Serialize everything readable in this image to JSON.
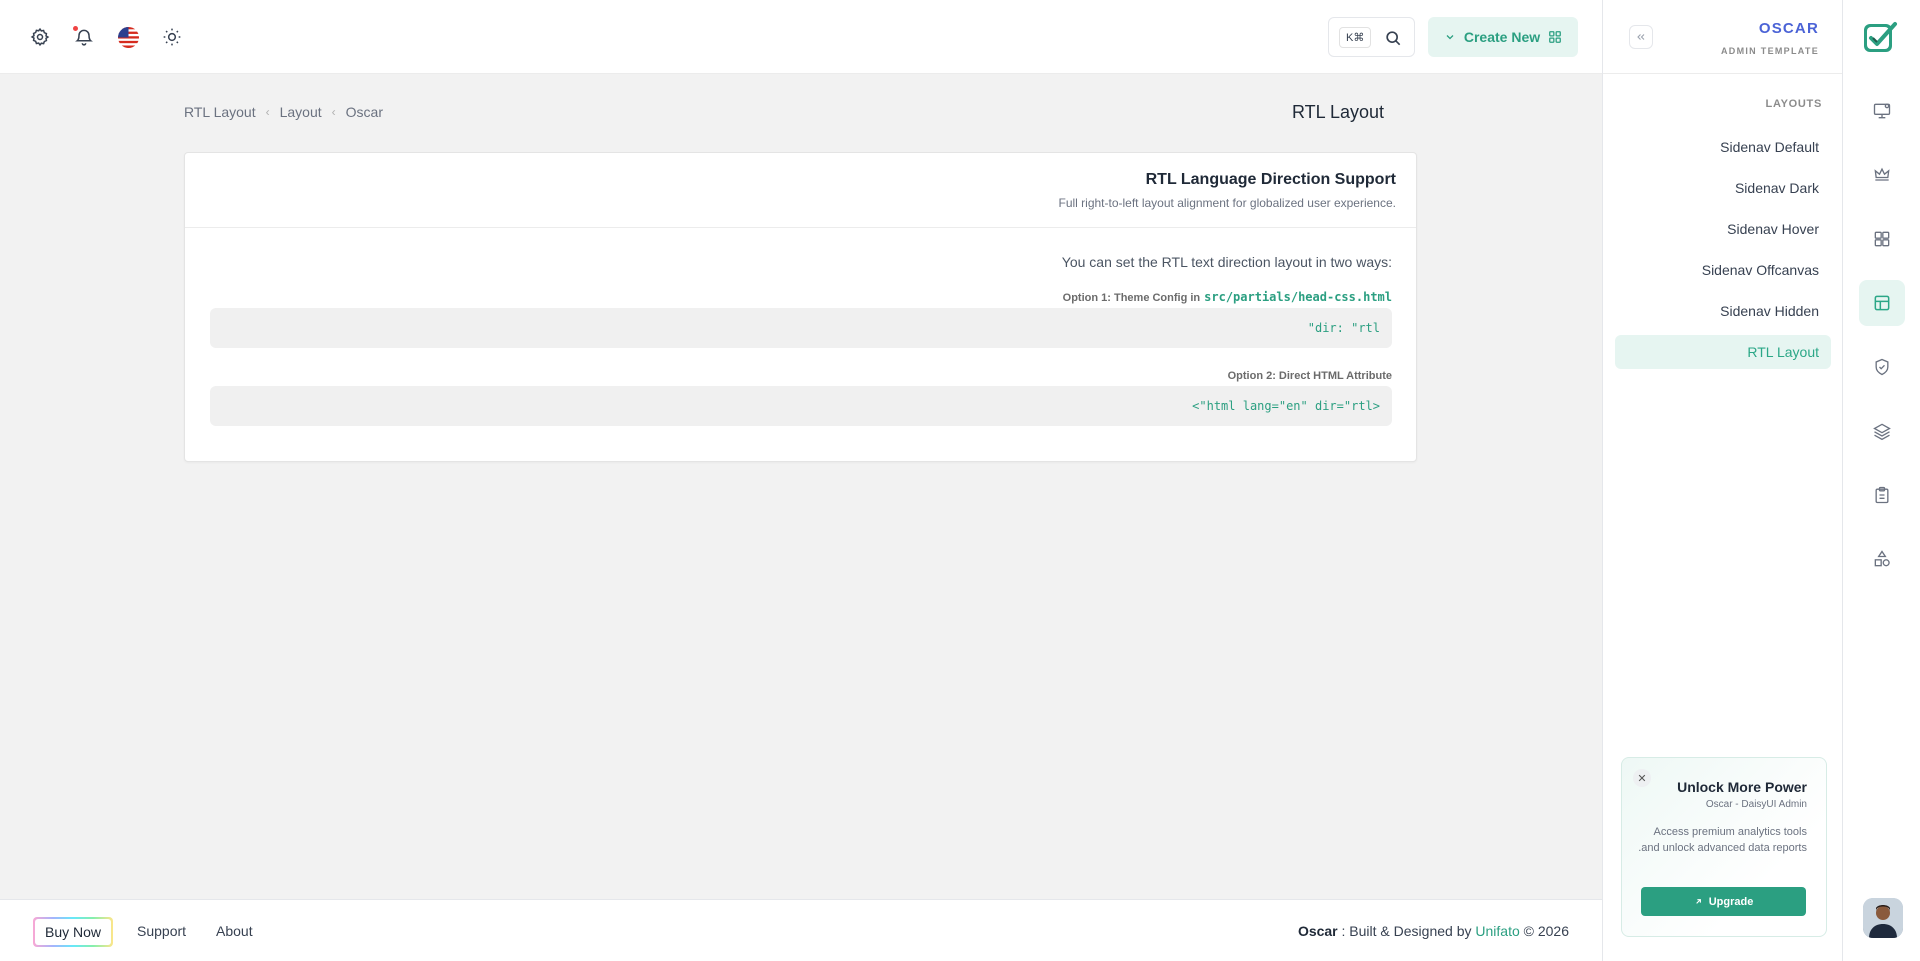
{
  "topbar": {
    "icons": [
      "settings-icon",
      "bell-icon",
      "us-flag-icon",
      "sun-icon"
    ],
    "shortcut": "K⌘",
    "create_label": "Create New"
  },
  "sidebar": {
    "brand": "OSCAR",
    "brand_sub": "ADMIN TEMPLATE",
    "section": "LAYOUTS",
    "items": [
      {
        "label": "Sidenav Default"
      },
      {
        "label": "Sidenav Dark"
      },
      {
        "label": "Sidenav Hover"
      },
      {
        "label": "Sidenav Offcanvas"
      },
      {
        "label": "Sidenav Hidden"
      },
      {
        "label": "RTL Layout",
        "active": true
      }
    ],
    "promo": {
      "title": "Unlock More Power",
      "subtitle": "Oscar - DaisyUI Admin",
      "description": "Access premium analytics tools and unlock advanced data reports.",
      "button": "Upgrade"
    }
  },
  "rail": {
    "icons": [
      "monitor-icon",
      "crown-icon",
      "apps-icon",
      "layout-icon",
      "shield-check-icon",
      "layers-icon",
      "clipboard-icon",
      "shapes-icon"
    ],
    "active": "layout-icon"
  },
  "breadcrumb": [
    "RTL Layout",
    "Layout",
    "Oscar"
  ],
  "page_title": "RTL Layout",
  "card": {
    "title": "RTL Language Direction Support",
    "subtitle": "Full right-to-left layout alignment for globalized user experience.",
    "intro": "You can set the RTL text direction layout in two ways:",
    "option1_label": "Option 1: Theme Config in",
    "option1_path": "src/partials/head-css.html",
    "option1_code": "\"dir: \"rtl",
    "option2_label": "Option 2: Direct HTML Attribute",
    "option2_code": "<\"html lang=\"en\" dir=\"rtl>"
  },
  "footer": {
    "buy": "Buy Now",
    "links": [
      "Support",
      "About"
    ],
    "brand": "Oscar",
    "credit_text": " : Built & Designed by ",
    "credit_link": "Unifato",
    "year": "© 2026"
  },
  "colors": {
    "accent": "#2b9f81",
    "accent_soft": "#e6f5f1",
    "brand_blue": "#4b63d6",
    "background": "#f2f2f2"
  }
}
